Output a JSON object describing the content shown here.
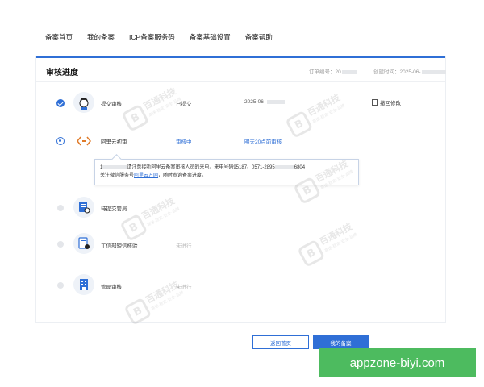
{
  "nav": {
    "items": [
      "备案首页",
      "我的备案",
      "ICP备案服务码",
      "备案基础设置",
      "备案帮助"
    ]
  },
  "card": {
    "title": "审核进度",
    "order_label": "订单编号：20",
    "created_label": "创建时间：2025-06-"
  },
  "steps": [
    {
      "name": "提交审核",
      "status": "已提交",
      "time": "2025-06-",
      "state": "done",
      "icon": "avatar-icon"
    },
    {
      "name": "阿里云初审",
      "status": "审核中",
      "time": "明天20点前审核",
      "state": "current",
      "icon": "code-icon"
    },
    {
      "name": "待提交管局",
      "status": "",
      "time": "",
      "state": "pending",
      "icon": "document-upload-icon"
    },
    {
      "name": "工信部短信核验",
      "status": "未进行",
      "time": "",
      "state": "pending",
      "icon": "sms-verify-icon"
    },
    {
      "name": "管局审核",
      "status": "未进行",
      "time": "",
      "state": "pending",
      "icon": "building-icon"
    }
  ],
  "withdraw_label": "撤回修改",
  "tooltip": {
    "line1_prefix": "1",
    "line1_mid": "请注意接听阿里云备案审核人员的来电，来电号码95187、0571-2895",
    "line1_suffix": "6804",
    "line2_prefix": "关注微信服务号",
    "line2_link": "阿里云万网",
    "line2_suffix": "，随时查询备案进度。"
  },
  "buttons": {
    "back": "返回首页",
    "mine": "我的备案"
  },
  "watermark": {
    "title": "百通科技",
    "subtitle": "高速·稳定·安全·品牌"
  },
  "banner": "appzone-biyi.com",
  "colors": {
    "accent": "#2f6fd6",
    "banner": "#4dbb5f"
  }
}
